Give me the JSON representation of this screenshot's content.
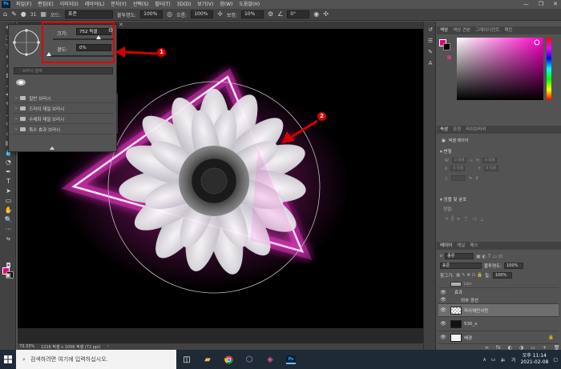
{
  "app": {
    "logo": "Ps",
    "menu": [
      "파일(F)",
      "편집(E)",
      "이미지(I)",
      "레이어(L)",
      "문자(Y)",
      "선택(S)",
      "필터(T)",
      "3D(D)",
      "보기(V)",
      "창(W)",
      "도움말(H)"
    ],
    "window_controls": [
      "—",
      "❐",
      "✕"
    ]
  },
  "options_bar": {
    "brush_size": "31",
    "mode_label": "모드:",
    "mode_value": "표준",
    "opacity_label": "불투명도:",
    "opacity_value": "100%",
    "flow_label": "흐름:",
    "flow_value": "100%",
    "smoothing_label": "보정:",
    "smoothing_value": "10%",
    "angle_value": "0°"
  },
  "document_tab": {
    "close_glyph": "✕"
  },
  "brush_popup": {
    "size_label": "크기:",
    "size_value": "752 픽셀",
    "hardness_label": "경도:",
    "hardness_value": "0%",
    "size_fraction": 0.75,
    "hardness_fraction": 0.0,
    "search_placeholder": "브러시 검색",
    "folders": [
      "일반 브러시",
      "드라이 재질 브러시",
      "수채화 재질 브러시",
      "특수 효과 브러시"
    ]
  },
  "annotations": {
    "callout_1": "1",
    "callout_2": "2",
    "accent_red": "#d40000"
  },
  "status_bar": {
    "zoom": "73.33%",
    "doc_info": "1216 픽셀 x 1056 픽셀 (72 ppi)"
  },
  "color_panel": {
    "tabs": [
      "색상",
      "색상 견본",
      "그레이디언트",
      "패턴"
    ],
    "foreground": "#e6007e",
    "background": "#000000"
  },
  "properties_panel": {
    "tabs": [
      "속성",
      "조정",
      "라이브러리"
    ],
    "layer_kind": "픽셀 레이어",
    "transform_title": "변형",
    "align_title": "정렬 및 분포",
    "align_sub": "정렬:",
    "w_label": "W",
    "h_label": "H",
    "x_label": "X",
    "y_label": "Y",
    "w_value": "0 픽셀",
    "h_value": "0 픽셀",
    "x_value": "0 픽셀",
    "y_value": "0 픽셀"
  },
  "layers_panel": {
    "tabs": [
      "레이어",
      "채널",
      "패스"
    ],
    "kind_filter": "종류",
    "blend_mode": "표준",
    "opacity_label": "불투명도:",
    "opacity_value": "100%",
    "lock_label": "잠그기:",
    "fill_label": "칠:",
    "fill_value": "100%",
    "layers": [
      {
        "name": "Lkn",
        "thumb": "white",
        "visible": false,
        "selected": false
      },
      {
        "name": "효과",
        "thumb": "none",
        "visible": true,
        "selected": false,
        "indent": true
      },
      {
        "name": "외부 광선",
        "thumb": "none",
        "visible": true,
        "selected": false,
        "indent": true
      },
      {
        "name": "피사체만사랑",
        "thumb": "checker",
        "visible": true,
        "selected": true
      },
      {
        "name": "530_x",
        "thumb": "black",
        "visible": true,
        "selected": false
      },
      {
        "name": "배경",
        "thumb": "white",
        "visible": true,
        "selected": false
      }
    ],
    "bottom_icons": [
      "fx",
      "◐",
      "◑",
      "▭",
      "+",
      "🗑"
    ]
  },
  "taskbar": {
    "search_placeholder": "검색하려면 여기에 입력하십시오.",
    "ime": "가",
    "time": "오후 11:14",
    "date": "2021-02-08"
  }
}
